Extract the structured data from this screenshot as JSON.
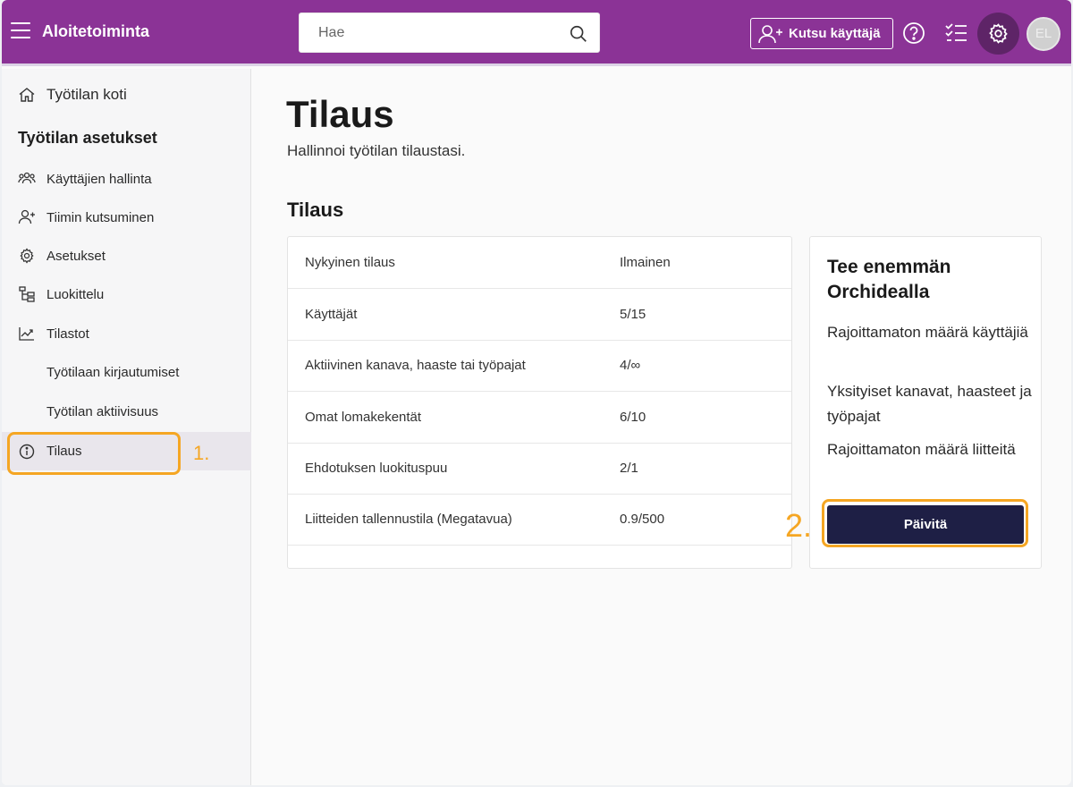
{
  "header": {
    "app_title": "Aloitetoiminta",
    "search_placeholder": "Hae",
    "invite_label": "Kutsu käyttäjä",
    "avatar_initials": "EL",
    "icons": [
      "menu-icon",
      "search-icon",
      "add-user-icon",
      "help-icon",
      "checklist-icon",
      "gear-icon"
    ],
    "colors": {
      "bar": "#8b3396",
      "gear_bg": "#5e2467"
    }
  },
  "sidebar": {
    "home": "Työtilan koti",
    "heading": "Työtilan asetukset",
    "items": [
      {
        "label": "Käyttäjien hallinta",
        "icon": "users-icon"
      },
      {
        "label": "Tiimin kutsuminen",
        "icon": "add-user-icon"
      },
      {
        "label": "Asetukset",
        "icon": "gear-icon"
      },
      {
        "label": "Luokittelu",
        "icon": "hierarchy-icon"
      },
      {
        "label": "Tilastot",
        "icon": "trend-icon"
      },
      {
        "label": "Työtilaan kirjautumiset",
        "icon": ""
      },
      {
        "label": "Työtilan aktiivisuus",
        "icon": ""
      },
      {
        "label": "Tilaus",
        "icon": "info-icon",
        "active": true
      }
    ]
  },
  "annotations": {
    "step1": "1.",
    "step2": "2.",
    "highlight_color": "#f5a623"
  },
  "main": {
    "title": "Tilaus",
    "subtitle": "Hallinnoi työtilan tilaustasi.",
    "section_title": "Tilaus",
    "subscription_rows": [
      {
        "key": "Nykyinen tilaus",
        "value": "Ilmainen"
      },
      {
        "key": "Käyttäjät",
        "value": "5/15"
      },
      {
        "key": "Aktiivinen kanava, haaste tai työpajat",
        "value": "4/∞"
      },
      {
        "key": "Omat lomakekentät",
        "value": "6/10"
      },
      {
        "key": "Ehdotuksen luokituspuu",
        "value": "2/1"
      },
      {
        "key": "Liitteiden tallennustila (Megatavua)",
        "value": "0.9/500"
      }
    ],
    "promo": {
      "title": "Tee enemmän Orchidealla",
      "features": [
        "Rajoittamaton määrä käyttäjiä",
        "Yksityiset kanavat, haasteet ja työpajat",
        "Rajoittamaton määrä liitteitä"
      ],
      "button_label": "Päivitä",
      "button_color": "#1e1f45"
    }
  }
}
